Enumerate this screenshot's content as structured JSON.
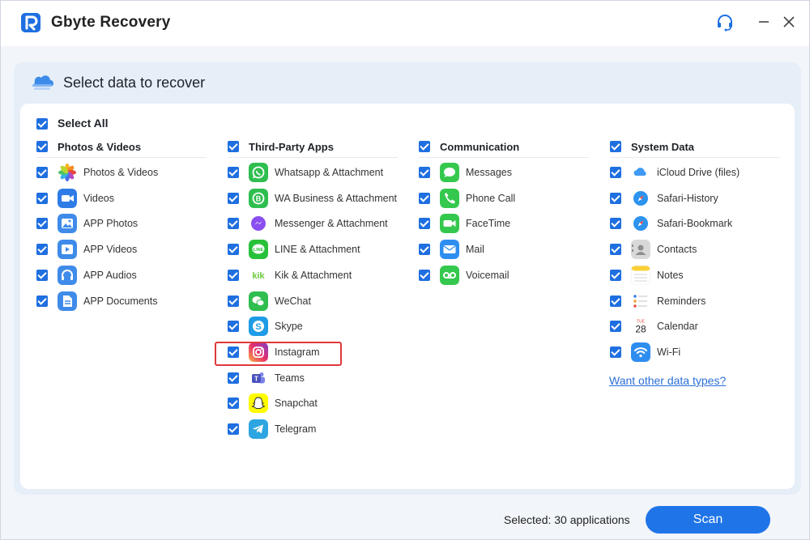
{
  "app": {
    "title": "Gbyte Recovery"
  },
  "panel": {
    "title": "Select data to recover"
  },
  "select_all": {
    "label": "Select All",
    "checked": true
  },
  "columns": [
    {
      "header": "Photos & Videos",
      "items": [
        {
          "label": "Photos & Videos",
          "icon": "photos-icon",
          "checked": true
        },
        {
          "label": "Videos",
          "icon": "videos-icon",
          "checked": true
        },
        {
          "label": "APP Photos",
          "icon": "app-photos-icon",
          "checked": true
        },
        {
          "label": "APP Videos",
          "icon": "app-videos-icon",
          "checked": true
        },
        {
          "label": "APP Audios",
          "icon": "app-audios-icon",
          "checked": true
        },
        {
          "label": "APP Documents",
          "icon": "app-documents-icon",
          "checked": true
        }
      ]
    },
    {
      "header": "Third-Party Apps",
      "items": [
        {
          "label": "Whatsapp & Attachment",
          "icon": "whatsapp-icon",
          "checked": true
        },
        {
          "label": "WA Business & Attachment",
          "icon": "wa-business-icon",
          "checked": true
        },
        {
          "label": "Messenger & Attachment",
          "icon": "messenger-icon",
          "checked": true
        },
        {
          "label": "LINE & Attachment",
          "icon": "line-icon",
          "checked": true
        },
        {
          "label": "Kik & Attachment",
          "icon": "kik-icon",
          "checked": true
        },
        {
          "label": "WeChat",
          "icon": "wechat-icon",
          "checked": true
        },
        {
          "label": "Skype",
          "icon": "skype-icon",
          "checked": true
        },
        {
          "label": "Instagram",
          "icon": "instagram-icon",
          "checked": true,
          "highlighted": true
        },
        {
          "label": "Teams",
          "icon": "teams-icon",
          "checked": true
        },
        {
          "label": "Snapchat",
          "icon": "snapchat-icon",
          "checked": true
        },
        {
          "label": "Telegram",
          "icon": "telegram-icon",
          "checked": true
        }
      ]
    },
    {
      "header": "Communication",
      "items": [
        {
          "label": "Messages",
          "icon": "messages-icon",
          "checked": true
        },
        {
          "label": "Phone Call",
          "icon": "phone-icon",
          "checked": true
        },
        {
          "label": "FaceTime",
          "icon": "facetime-icon",
          "checked": true
        },
        {
          "label": "Mail",
          "icon": "mail-icon",
          "checked": true
        },
        {
          "label": "Voicemail",
          "icon": "voicemail-icon",
          "checked": true
        }
      ]
    },
    {
      "header": "System Data",
      "items": [
        {
          "label": "iCloud Drive (files)",
          "icon": "icloud-drive-icon",
          "checked": true
        },
        {
          "label": "Safari-History",
          "icon": "safari-history-icon",
          "checked": true
        },
        {
          "label": "Safari-Bookmark",
          "icon": "safari-bookmark-icon",
          "checked": true
        },
        {
          "label": "Contacts",
          "icon": "contacts-icon",
          "checked": true
        },
        {
          "label": "Notes",
          "icon": "notes-icon",
          "checked": true
        },
        {
          "label": "Reminders",
          "icon": "reminders-icon",
          "checked": true
        },
        {
          "label": "Calendar",
          "icon": "calendar-icon",
          "checked": true,
          "calendar_day": "28",
          "calendar_weekday": "TUE"
        },
        {
          "label": "Wi-Fi",
          "icon": "wifi-icon",
          "checked": true
        }
      ]
    }
  ],
  "more_link": "Want other data types?",
  "footer": {
    "selected_text": "Selected: 30 applications",
    "scan_label": "Scan"
  },
  "colors": {
    "accent": "#1f74e8",
    "checkbox": "#1f6fe0",
    "highlight": "#e0383b",
    "link": "#2b6fd6"
  }
}
